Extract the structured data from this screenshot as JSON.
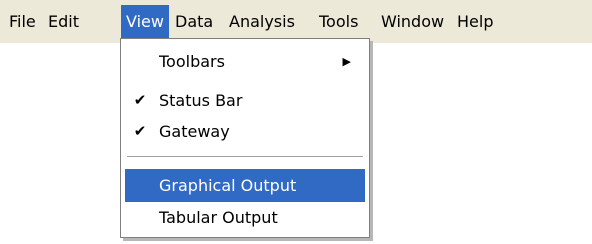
{
  "menubar": {
    "items": [
      {
        "label": "File"
      },
      {
        "label": "Edit"
      },
      {
        "label": "View"
      },
      {
        "label": "Data"
      },
      {
        "label": "Analysis"
      },
      {
        "label": "Tools"
      },
      {
        "label": "Window"
      },
      {
        "label": "Help"
      }
    ],
    "active": "View"
  },
  "view_menu": {
    "items": [
      {
        "label": "Toolbars",
        "checked": false,
        "submenu_icon": "submenu-arrow-icon"
      },
      {
        "label": "Status Bar",
        "checked": true,
        "check_icon": "checkmark-icon"
      },
      {
        "label": "Gateway",
        "checked": true,
        "check_icon": "checkmark-icon"
      },
      {
        "label": "Graphical Output",
        "checked": false,
        "highlighted": true
      },
      {
        "label": "Tabular Output",
        "checked": false
      }
    ]
  },
  "colors": {
    "menubar_bg": "#ece9d8",
    "highlight": "#316ac5",
    "highlight_text": "#ffffff",
    "menu_border": "#7f7f7f",
    "separator": "#a0a0a0"
  }
}
